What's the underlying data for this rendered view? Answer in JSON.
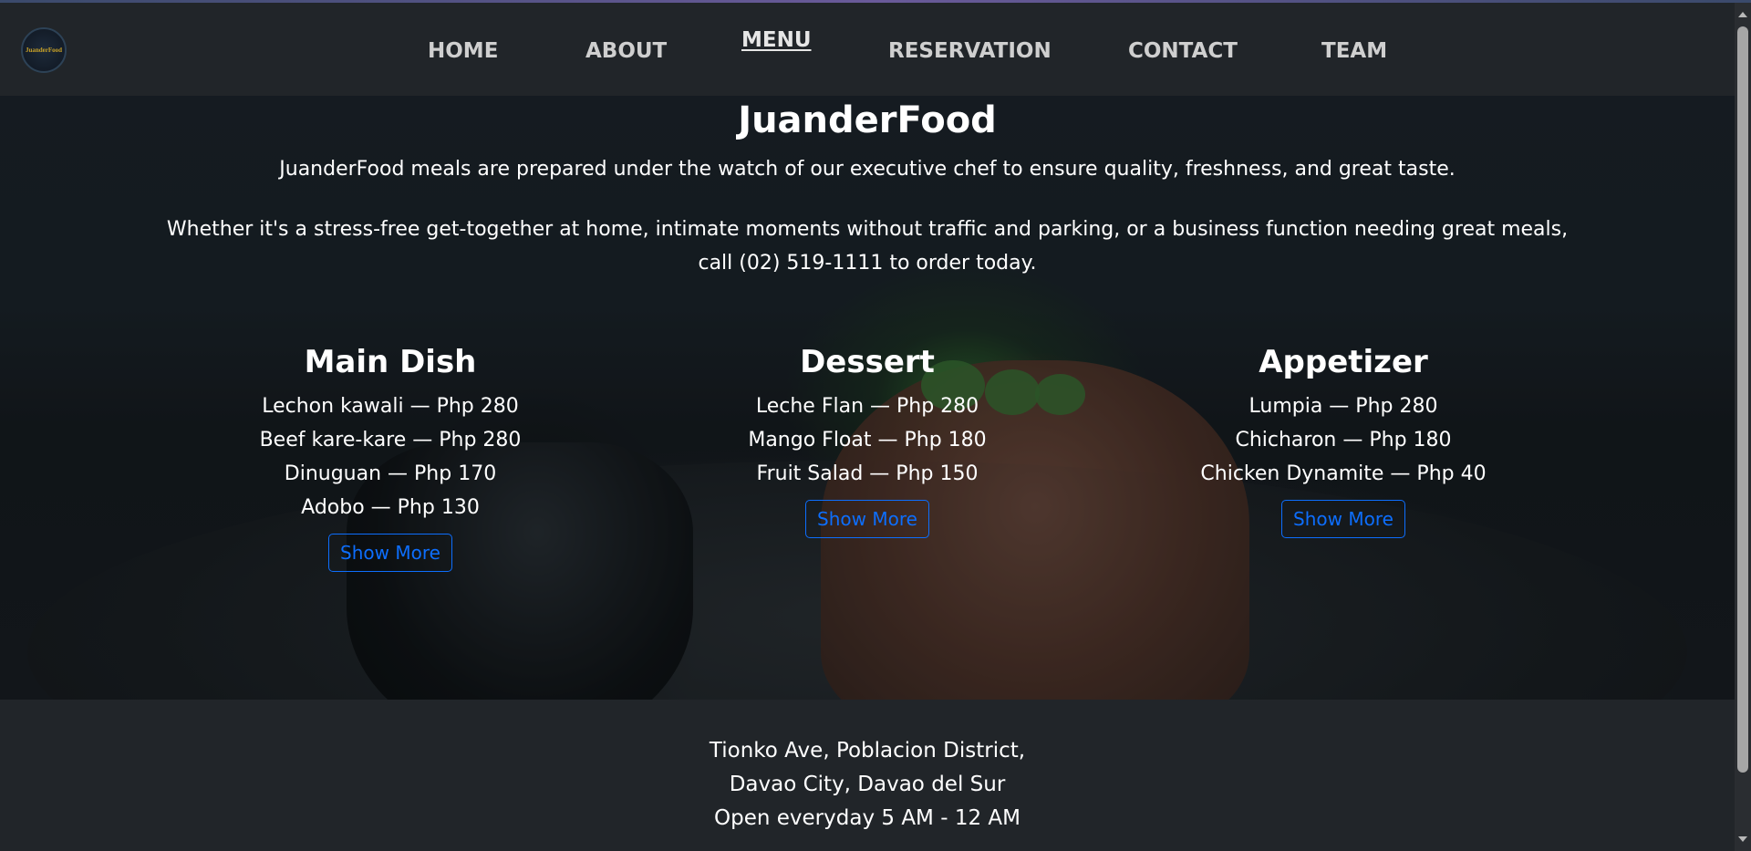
{
  "header": {
    "logo_text": "JuanderFood",
    "nav": [
      {
        "label": "HOME",
        "active": false
      },
      {
        "label": "ABOUT",
        "active": false
      },
      {
        "label": "MENU",
        "active": true
      },
      {
        "label": "RESERVATION",
        "active": false
      },
      {
        "label": "CONTACT",
        "active": false
      },
      {
        "label": "TEAM",
        "active": false
      }
    ]
  },
  "hero": {
    "title": "JuanderFood",
    "tagline": "JuanderFood meals are prepared under the watch of our executive chef to ensure quality, freshness, and great taste.",
    "invite": "Whether it's a stress-free get-together at home, intimate moments without traffic and parking, or a business function needing great meals, call (02) 519-1111 to order today."
  },
  "menu": [
    {
      "title": "Main Dish",
      "items": [
        "Lechon kawali — Php 280",
        "Beef kare-kare — Php 280",
        "Dinuguan — Php 170",
        "Adobo — Php 130"
      ],
      "button": "Show More"
    },
    {
      "title": "Dessert",
      "items": [
        "Leche Flan — Php 280",
        "Mango Float — Php 180",
        "Fruit Salad — Php 150"
      ],
      "button": "Show More"
    },
    {
      "title": "Appetizer",
      "items": [
        "Lumpia — Php 280",
        "Chicharon — Php 180",
        "Chicken Dynamite — Php 40"
      ],
      "button": "Show More"
    }
  ],
  "footer": {
    "address_line1": "Tionko Ave, Poblacion District,",
    "address_line2": "Davao City, Davao del Sur",
    "hours": "Open everyday 5 AM - 12 AM"
  },
  "colors": {
    "background": "#212529",
    "button_accent": "#0d6efd",
    "nav_text": "#cfcfcf"
  }
}
